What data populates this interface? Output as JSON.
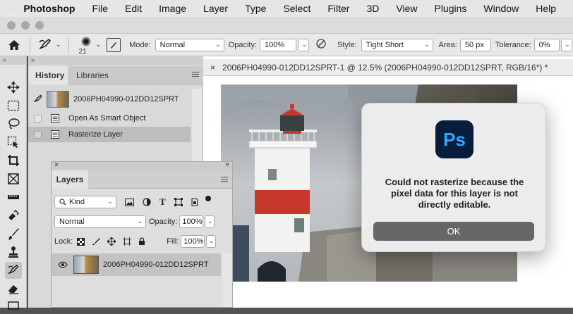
{
  "menubar": {
    "app": "Photoshop",
    "items": [
      "File",
      "Edit",
      "Image",
      "Layer",
      "Type",
      "Select",
      "Filter",
      "3D",
      "View",
      "Plugins",
      "Window",
      "Help"
    ]
  },
  "options_bar": {
    "brush_size": "21",
    "mode_label": "Mode:",
    "mode_value": "Normal",
    "opacity_label": "Opacity:",
    "opacity_value": "100%",
    "style_label": "Style:",
    "style_value": "Tight Short",
    "area_label": "Area:",
    "area_value": "50 px",
    "tolerance_label": "Tolerance:",
    "tolerance_value": "0%"
  },
  "history_panel": {
    "tabs": [
      "History",
      "Libraries"
    ],
    "snapshot": "2006PH04990-012DD12SPRT",
    "states": [
      "Open As Smart Object",
      "Rasterize Layer"
    ]
  },
  "document": {
    "tab_title": "2006PH04990-012DD12SPRT-1 @ 12.5% (2006PH04990-012DD12SPRT, RGB/16*) *"
  },
  "layers_panel": {
    "title": "Layers",
    "filter_value": "Kind",
    "blend_mode": "Normal",
    "opacity_label": "Opacity:",
    "opacity_value": "100%",
    "lock_label": "Lock:",
    "fill_label": "Fill:",
    "fill_value": "100%",
    "layer_name": "2006PH04990-012DD12SPRT"
  },
  "dialog": {
    "icon_text": "Ps",
    "message": "Could not rasterize because the pixel data for this layer is not directly editable.",
    "ok_label": "OK"
  },
  "colors": {
    "ps_blue_bg": "#061e3c",
    "ps_blue_text": "#31a8ff",
    "ok_button": "#676767",
    "lighthouse_red": "#c8382a"
  }
}
